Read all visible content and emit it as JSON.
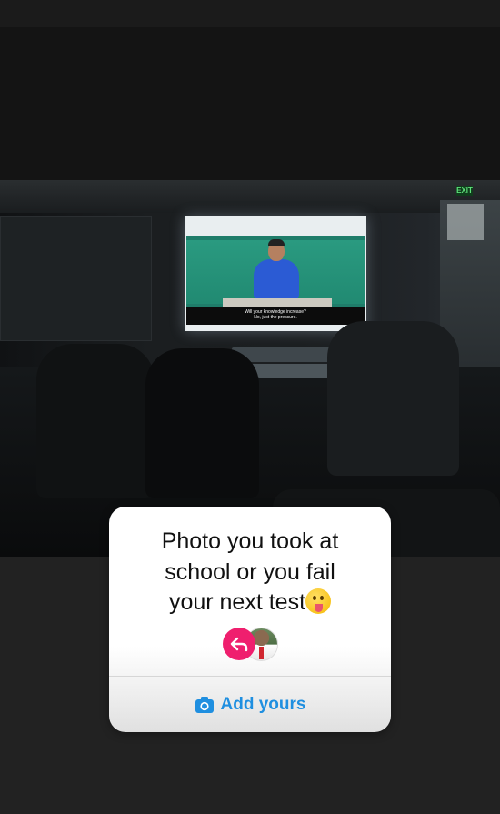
{
  "story": {
    "photo": {
      "subtitle_line1": "Will your knowledge increase?",
      "subtitle_line2": "No, just the pressure.",
      "exit_sign": "EXIT"
    },
    "add_yours_sticker": {
      "prompt": "Photo you took at\nschool or you fail\nyour next test",
      "emoji_icon": "tongue-out-emoji",
      "reply_icon": "reply-arrow-icon",
      "reply_badge_color": "#ef1f6e",
      "button_label": "Add yours",
      "button_icon": "camera-icon",
      "accent_color": "#1f8fe0"
    }
  }
}
